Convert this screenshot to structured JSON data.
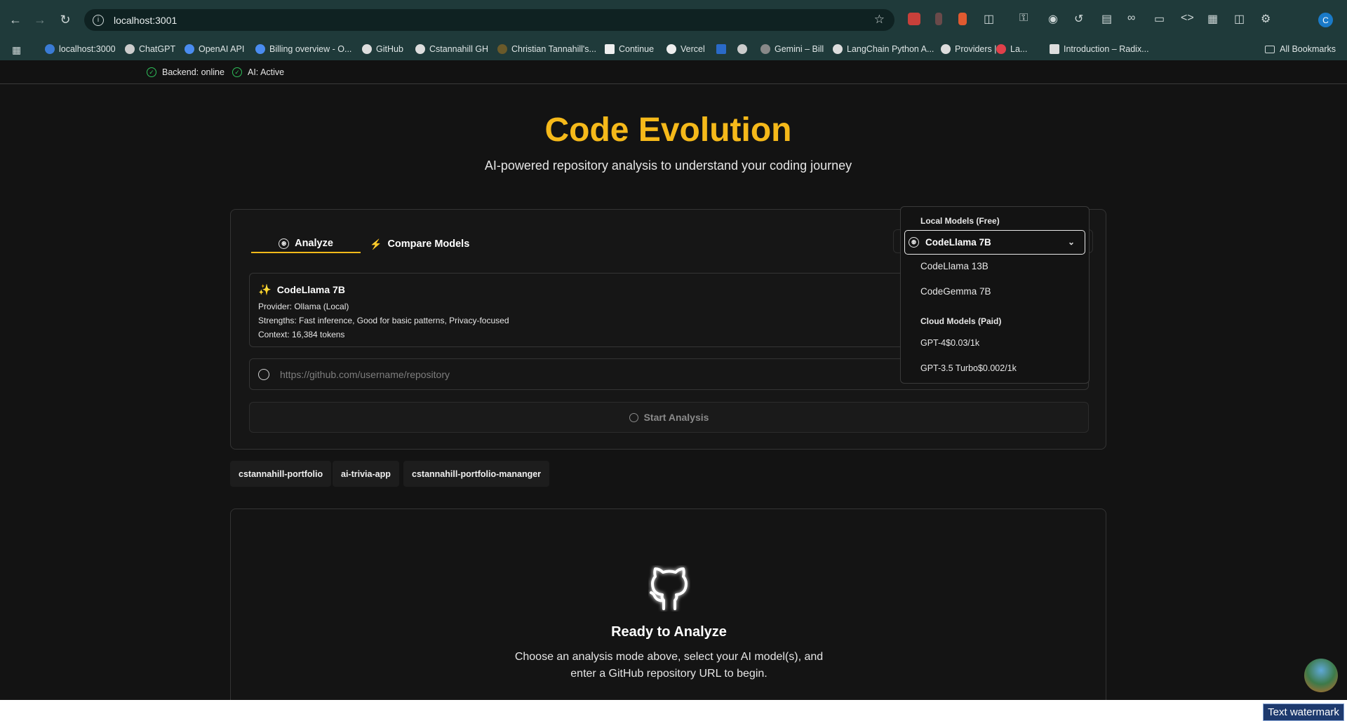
{
  "browser": {
    "url": "localhost:3001",
    "bookmarks": [
      {
        "label": "localhost:3000",
        "color": "#3a7bd5"
      },
      {
        "label": "ChatGPT",
        "color": "#cccccc"
      },
      {
        "label": "OpenAI API",
        "color": "#4a8cf0"
      },
      {
        "label": "Billing overview - O...",
        "color": "#4a8cf0"
      },
      {
        "label": "GitHub",
        "color": "#dddddd"
      },
      {
        "label": "Cstannahill GH",
        "color": "#dddddd"
      },
      {
        "label": "Christian Tannahill's...",
        "color": "#6a5a2a"
      },
      {
        "label": "Continue",
        "color": "#eeeeee"
      },
      {
        "label": "Vercel",
        "color": "#eeeeee"
      },
      {
        "label": "",
        "color": "#2a6ac8"
      },
      {
        "label": "",
        "color": "#cccccc"
      },
      {
        "label": "Gemini – Bill",
        "color": "#888888"
      },
      {
        "label": "LangChain Python A...",
        "color": "#dddddd"
      },
      {
        "label": "Providers | ",
        "color": "#dddddd"
      },
      {
        "label": "La...",
        "color": "#e0404a"
      },
      {
        "label": "Introduction – Radix...",
        "color": "#dddddd"
      }
    ],
    "all_bookmarks": "All Bookmarks",
    "profile_initial": "C"
  },
  "status": {
    "backend": "Backend: online",
    "ai": "AI: Active"
  },
  "hero": {
    "title": "Code Evolution",
    "subtitle": "AI-powered repository analysis to understand your coding journey"
  },
  "tabs": {
    "analyze": "Analyze",
    "compare": "Compare Models"
  },
  "model_info": {
    "name": "CodeLlama 7B",
    "provider": "Provider: Ollama (Local)",
    "strengths": "Strengths: Fast inference, Good for basic patterns, Privacy-focused",
    "context": "Context: 16,384 tokens"
  },
  "repo_input": {
    "placeholder": "https://github.com/username/repository"
  },
  "start_button": "Start Analysis",
  "chips": [
    "cstannahill-portfolio",
    "ai-trivia-app",
    "cstannahill-portfolio-mananger"
  ],
  "empty_state": {
    "title": "Ready to Analyze",
    "line1": "Choose an analysis mode above, select your AI model(s), and",
    "line2": "enter a GitHub repository URL to begin."
  },
  "dropdown": {
    "local_group": "Local Models (Free)",
    "selected": "CodeLlama 7B",
    "local_items": [
      "CodeLlama 13B",
      "CodeGemma 7B"
    ],
    "cloud_group": "Cloud Models (Paid)",
    "cloud_items": [
      "GPT-4$0.03/1k",
      "GPT-3.5 Turbo$0.002/1k"
    ]
  },
  "watermark": "Text watermark",
  "colors": {
    "accent": "#f5b91a",
    "status_ok": "#2fbf5a",
    "chrome": "#1f3a3a"
  }
}
